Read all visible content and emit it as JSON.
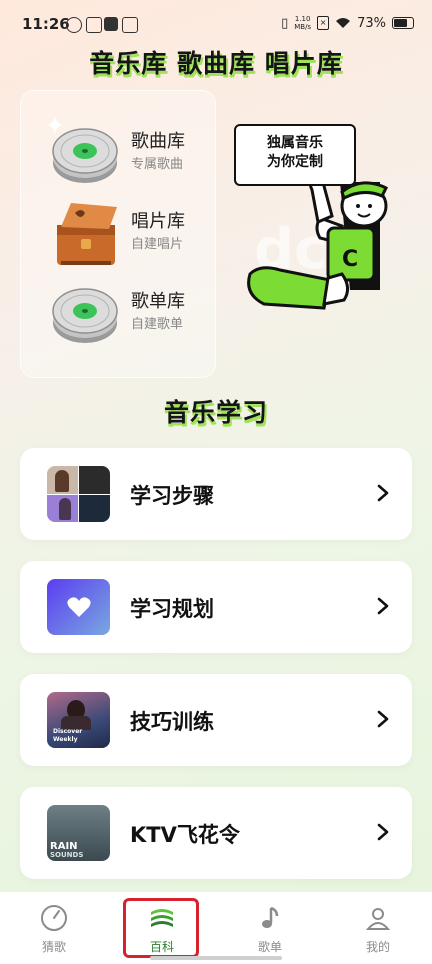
{
  "status": {
    "time": "11:26",
    "net_speed_top": "1.10",
    "net_speed_bottom": "MB/s",
    "battery": "73%"
  },
  "hero": {
    "title": "音乐库 歌曲库 唱片库"
  },
  "libraries": [
    {
      "name": "歌曲库",
      "sub": "专属歌曲",
      "icon": "vinyl-disc-icon"
    },
    {
      "name": "唱片库",
      "sub": "自建唱片",
      "icon": "gramophone-icon"
    },
    {
      "name": "歌单库",
      "sub": "自建歌单",
      "icon": "vinyl-disc-icon"
    }
  ],
  "mascot": {
    "bubble_line1": "独属音乐",
    "bubble_line2": "为你定制",
    "shirt_letter": "C"
  },
  "section": {
    "title": "音乐学习"
  },
  "cards": [
    {
      "label": "学习步骤",
      "icon": "photo-collage-thumb"
    },
    {
      "label": "学习规划",
      "icon": "heart-icon"
    },
    {
      "label": "技巧训练",
      "icon": "discover-weekly-thumb",
      "thumb_text_1": "Discover",
      "thumb_text_2": "Weekly"
    },
    {
      "label": "KTV飞花令",
      "icon": "rain-sounds-thumb",
      "thumb_text_1": "RAIN",
      "thumb_text_2": "SOUNDS"
    }
  ],
  "tabs": [
    {
      "label": "猜歌",
      "icon": "gauge-icon"
    },
    {
      "label": "百科",
      "icon": "wave-logo-icon",
      "active": true
    },
    {
      "label": "歌单",
      "icon": "music-note-icon"
    },
    {
      "label": "我的",
      "icon": "person-icon"
    }
  ],
  "colors": {
    "accent_green": "#9fe35a",
    "active_tab": "#2e7d32",
    "highlight_red": "#d6222d"
  }
}
